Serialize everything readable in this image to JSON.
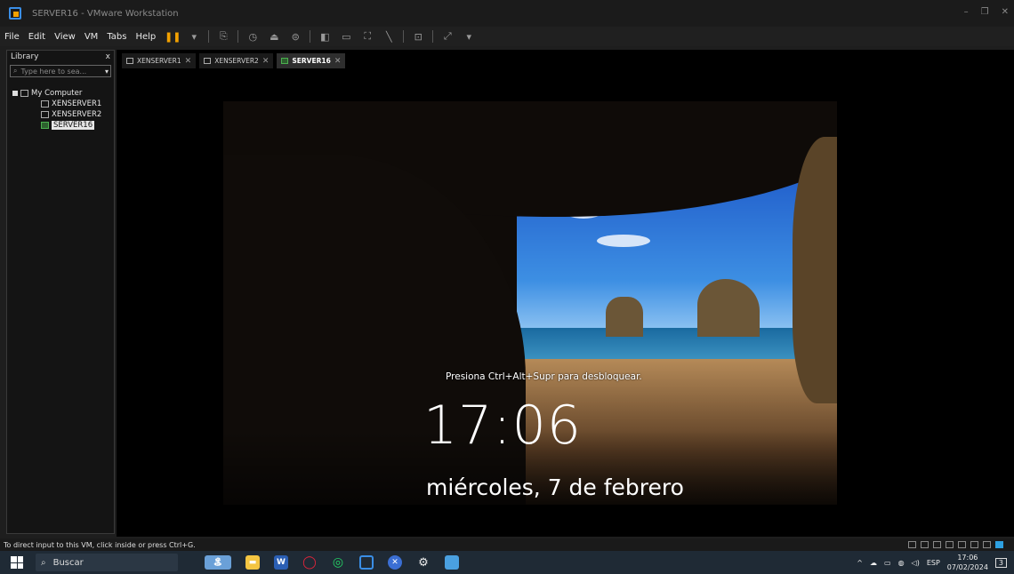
{
  "window": {
    "title": "SERVER16 - VMware Workstation",
    "controls": [
      "–",
      "❐",
      "✕"
    ]
  },
  "menu": [
    "File",
    "Edit",
    "View",
    "VM",
    "Tabs",
    "Help"
  ],
  "sidebar": {
    "title": "Library",
    "close": "x",
    "search_placeholder": "Type here to sea...",
    "tree": {
      "root": "My Computer",
      "items": [
        "XENSERVER1",
        "XENSERVER2",
        "SERVER16"
      ]
    }
  },
  "tabs": [
    {
      "label": "XENSERVER1",
      "close": "✕"
    },
    {
      "label": "XENSERVER2",
      "close": "✕"
    },
    {
      "label": "SERVER16",
      "close": "✕",
      "active": true
    }
  ],
  "lockscreen": {
    "hint": "Presiona Ctrl+Alt+Supr para desbloquear.",
    "time": "17:06",
    "date": "miércoles, 7 de febrero"
  },
  "status": {
    "message": "To direct input to this VM, click inside or press Ctrl+G."
  },
  "taskbar": {
    "search": "Buscar",
    "lang": "ESP",
    "time": "17:06",
    "date": "07/02/2024",
    "notifications": "3"
  }
}
